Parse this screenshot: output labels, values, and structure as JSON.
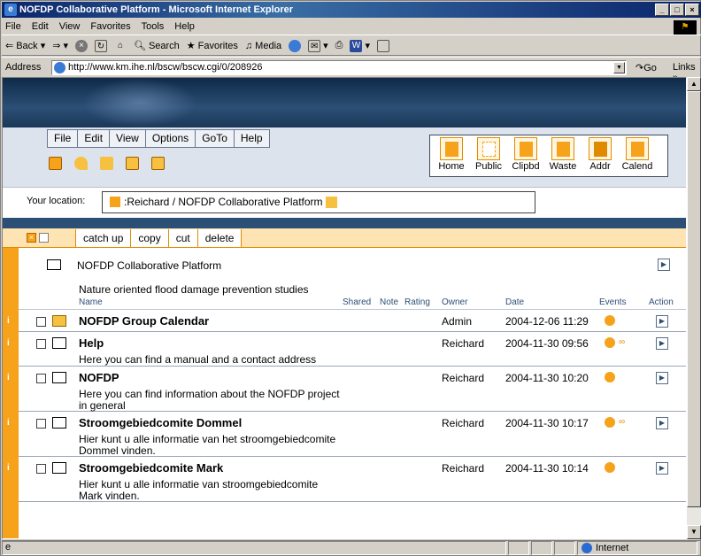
{
  "window": {
    "title": "NOFDP Collaborative Platform - Microsoft Internet Explorer"
  },
  "ie_menu": [
    "File",
    "Edit",
    "View",
    "Favorites",
    "Tools",
    "Help"
  ],
  "ie_toolbar": {
    "back": "Back",
    "search": "Search",
    "favorites": "Favorites",
    "media": "Media"
  },
  "address": {
    "label": "Address",
    "url": "http://www.km.ihe.nl/bscw/bscw.cgi/0/208926",
    "go": "Go",
    "links": "Links"
  },
  "app_menu": [
    "File",
    "Edit",
    "View",
    "Options",
    "GoTo",
    "Help"
  ],
  "nav_buttons": [
    "Home",
    "Public",
    "Clipbd",
    "Waste",
    "Addr",
    "Calend"
  ],
  "location": {
    "label": "Your location:",
    "path": ":Reichard / NOFDP Collaborative Platform"
  },
  "actions": [
    "catch up",
    "copy",
    "cut",
    "delete"
  ],
  "folder": {
    "name": "NOFDP Collaborative Platform",
    "description": "Nature oriented flood damage prevention studies"
  },
  "columns": {
    "name": "Name",
    "shared": "Shared",
    "note": "Note",
    "rating": "Rating",
    "owner": "Owner",
    "date": "Date",
    "events": "Events",
    "action": "Action"
  },
  "rows": [
    {
      "name": "NOFDP Group Calendar",
      "description": "",
      "owner": "Admin",
      "date": "2004-12-06 11:29",
      "icon": "calendar-icon",
      "glasses": false
    },
    {
      "name": "Help",
      "description": "Here you can find a manual and a contact address",
      "owner": "Reichard",
      "date": "2004-11-30 09:56",
      "icon": "folder-icon",
      "glasses": true
    },
    {
      "name": "NOFDP",
      "description": "Here you can find information about the NOFDP project in general",
      "owner": "Reichard",
      "date": "2004-11-30 10:20",
      "icon": "folder-icon",
      "glasses": false
    },
    {
      "name": "Stroomgebiedcomite Dommel",
      "description": "Hier kunt u alle informatie van het stroomgebiedcomite Dommel vinden.",
      "owner": "Reichard",
      "date": "2004-11-30 10:17",
      "icon": "folder-icon",
      "glasses": true
    },
    {
      "name": "Stroomgebiedcomite Mark",
      "description": "Hier kunt u alle informatie van stroomgebiedcomite Mark vinden.",
      "owner": "Reichard",
      "date": "2004-11-30 10:14",
      "icon": "folder-icon",
      "glasses": false
    }
  ],
  "row_info_label": "i",
  "status": {
    "zone": "Internet"
  },
  "colors": {
    "accent": "#f6a21a",
    "navy": "#2c4f76",
    "ie_title": "#0a246a"
  }
}
